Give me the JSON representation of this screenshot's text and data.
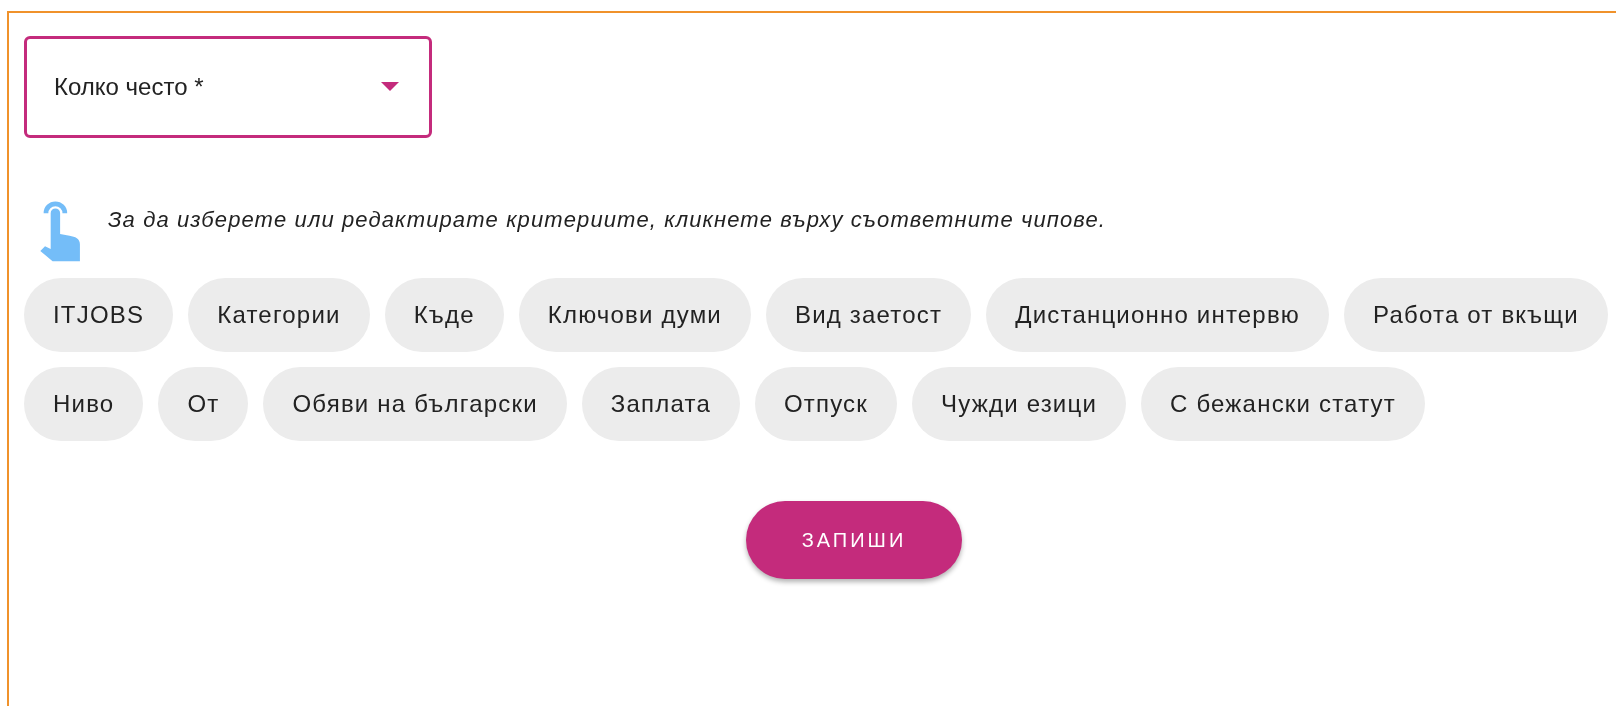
{
  "frequency_select": {
    "label": "Колко често *",
    "focused": true
  },
  "hint": {
    "text": "За да изберете или редактирате критериите, кликнете върху съответните чипове."
  },
  "chips": [
    {
      "label": "ITJOBS"
    },
    {
      "label": "Категории"
    },
    {
      "label": "Къде"
    },
    {
      "label": "Ключови думи"
    },
    {
      "label": "Вид заетост"
    },
    {
      "label": "Дистанционно интервю"
    },
    {
      "label": "Работа от вкъщи"
    },
    {
      "label": "Ниво"
    },
    {
      "label": "От"
    },
    {
      "label": "Обяви на български"
    },
    {
      "label": "Заплата"
    },
    {
      "label": "Отпуск"
    },
    {
      "label": "Чужди езици"
    },
    {
      "label": "С бежански статут"
    }
  ],
  "save_button": {
    "label": "ЗАПИШИ"
  }
}
